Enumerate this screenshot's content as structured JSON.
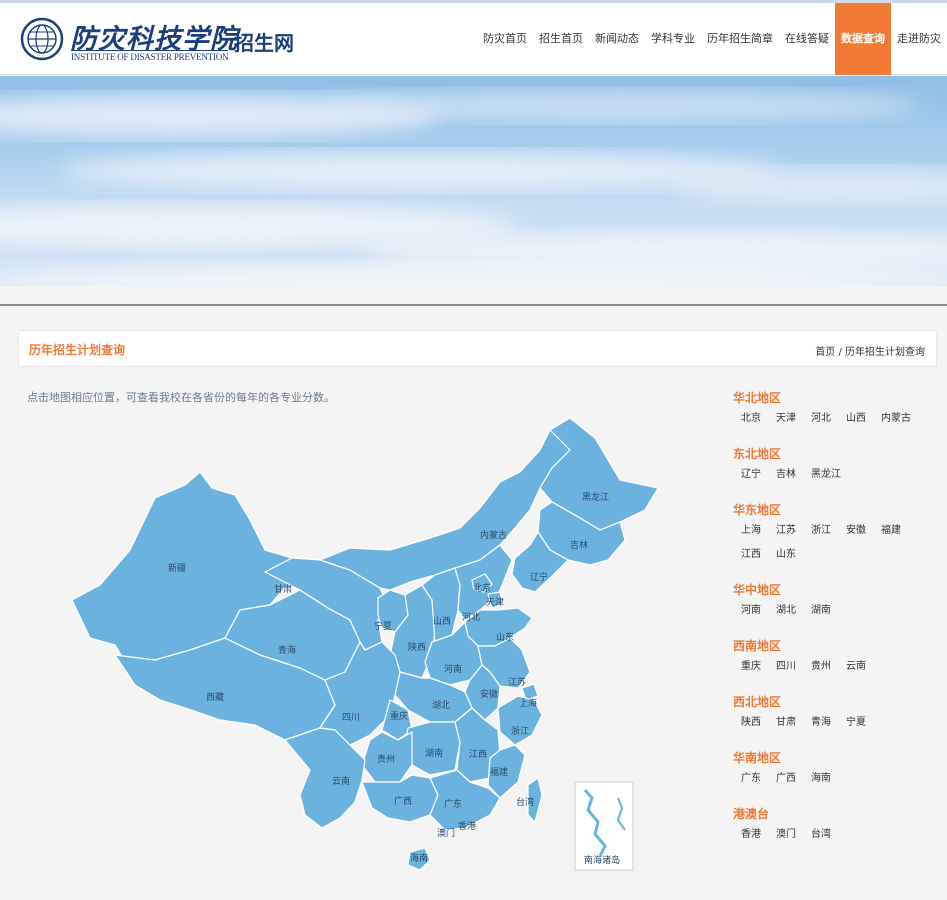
{
  "header": {
    "logo_cn": "防灾科技学院",
    "logo_en": "INSTITUTE OF DISASTER PREVENTION",
    "logo_sub": "招生网",
    "nav": [
      {
        "label": "防灾首页",
        "active": false
      },
      {
        "label": "招生首页",
        "active": false
      },
      {
        "label": "新闻动态",
        "active": false
      },
      {
        "label": "学科专业",
        "active": false
      },
      {
        "label": "历年招生简章",
        "active": false
      },
      {
        "label": "在线答疑",
        "active": false
      },
      {
        "label": "数据查询",
        "active": true
      },
      {
        "label": "走进防灾",
        "active": false
      }
    ]
  },
  "page": {
    "title": "历年招生计划查询",
    "breadcrumb": "首页 / 历年招生计划查询",
    "intro": "点击地图相应位置，可查看我校在各省份的每年的各专业分数。"
  },
  "map": {
    "fill": "#6bb3de",
    "stroke": "#ffffff",
    "labels": [
      "新疆",
      "西藏",
      "青海",
      "甘肃",
      "内蒙古",
      "黑龙江",
      "吉林",
      "辽宁",
      "北京",
      "天津",
      "河北",
      "山西",
      "宁夏",
      "陕西",
      "山东",
      "河南",
      "江苏",
      "安徽",
      "上海",
      "湖北",
      "四川",
      "重庆",
      "浙江",
      "湖南",
      "江西",
      "贵州",
      "云南",
      "福建",
      "广西",
      "广东",
      "台湾",
      "香港",
      "澳门",
      "海南",
      "南海诸岛"
    ]
  },
  "regions": [
    {
      "title": "华北地区",
      "provinces": [
        "北京",
        "天津",
        "河北",
        "山西",
        "内蒙古"
      ]
    },
    {
      "title": "东北地区",
      "provinces": [
        "辽宁",
        "吉林",
        "黑龙江"
      ]
    },
    {
      "title": "华东地区",
      "provinces": [
        "上海",
        "江苏",
        "浙江",
        "安徽",
        "福建",
        "江西",
        "山东"
      ]
    },
    {
      "title": "华中地区",
      "provinces": [
        "河南",
        "湖北",
        "湖南"
      ]
    },
    {
      "title": "西南地区",
      "provinces": [
        "重庆",
        "四川",
        "贵州",
        "云南"
      ]
    },
    {
      "title": "西北地区",
      "provinces": [
        "陕西",
        "甘肃",
        "青海",
        "宁夏"
      ]
    },
    {
      "title": "华南地区",
      "provinces": [
        "广东",
        "广西",
        "海南"
      ]
    },
    {
      "title": "港澳台",
      "provinces": [
        "香港",
        "澳门",
        "台湾"
      ]
    }
  ],
  "colors": {
    "accent": "#f07a36",
    "brand": "#1c3f7c",
    "map": "#6bb3de"
  }
}
